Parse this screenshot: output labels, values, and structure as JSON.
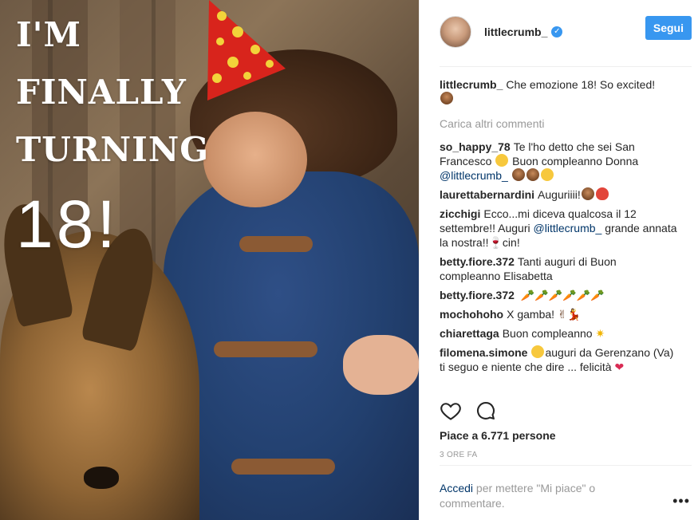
{
  "photo": {
    "overlay_lines": [
      "I'M",
      "FINALLY",
      "TURNING",
      "18!"
    ]
  },
  "header": {
    "username": "littlecrumb_",
    "verified_icon": "verified-badge-icon",
    "follow_label": "Segui"
  },
  "caption": {
    "author": "littlecrumb_",
    "text": "Che emozione 18! So excited!",
    "emoji": "cake"
  },
  "load_more_label": "Carica altri commenti",
  "comments": [
    {
      "author": "so_happy_78",
      "text": "Te l'ho detto che sei San Francesco",
      "text2": "Buon compleanno Donna",
      "mention": "@littlecrumb_"
    },
    {
      "author": "laurettabernardini",
      "text": "Auguriiii!"
    },
    {
      "author": "zicchigi",
      "text": "Ecco...mi diceva qualcosa il 12 settembre!! Auguri",
      "mention": "@littlecrumb_",
      "text2": "grande annata la nostra!!",
      "text3": "cin!"
    },
    {
      "author": "betty.fiore.372",
      "text": "Tanti auguri di Buon compleanno Elisabetta"
    },
    {
      "author": "betty.fiore.372",
      "text": ""
    },
    {
      "author": "mochohoho",
      "text": "X gamba!"
    },
    {
      "author": "chiarettaga",
      "text": "Buon compleanno"
    },
    {
      "author": "filomena.simone",
      "text": "auguri da Gerenzano (Va) ti seguo e niente che dire ... felicità"
    }
  ],
  "actions": {
    "like_icon": "heart-outline-icon",
    "comment_icon": "speech-bubble-icon"
  },
  "likes_text": "Piace a 6.771 persone",
  "time_text": "3 ORE FA",
  "login": {
    "link": "Accedi",
    "rest": "per mettere \"Mi piace\" o commentare."
  },
  "more_label": "•••",
  "colors": {
    "accent": "#3897f0",
    "mention": "#003569",
    "muted": "#999999"
  }
}
